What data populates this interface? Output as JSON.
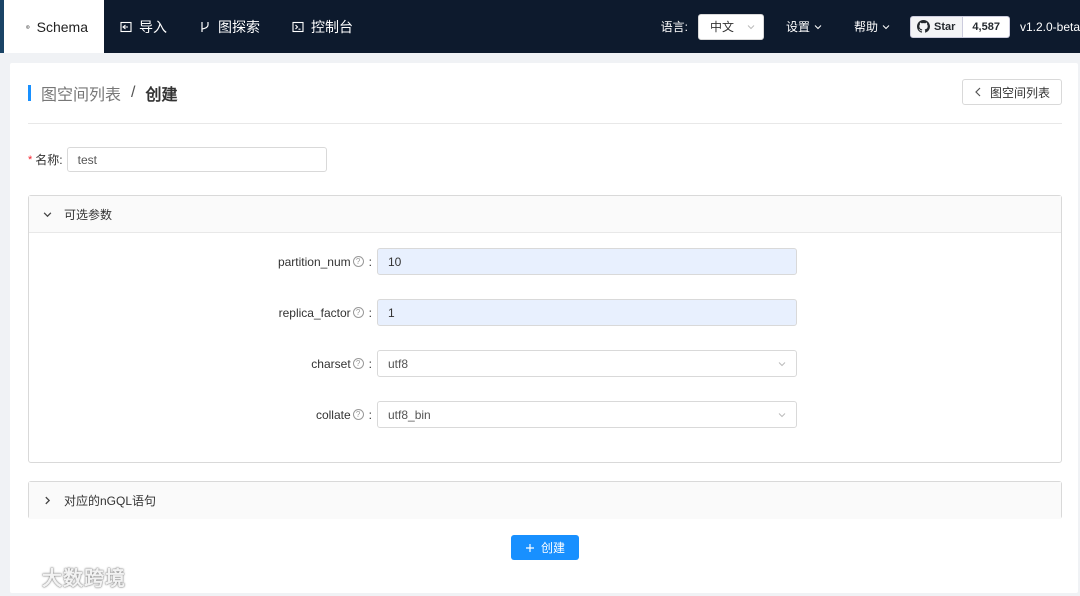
{
  "nav": {
    "items": [
      {
        "label": "Schema",
        "icon": "schema-icon"
      },
      {
        "label": "导入",
        "icon": "import-icon"
      },
      {
        "label": "图探索",
        "icon": "branch-icon"
      },
      {
        "label": "控制台",
        "icon": "console-icon"
      }
    ],
    "lang_label": "语言:",
    "lang_value": "中文",
    "settings": "设置",
    "help": "帮助",
    "github_star": "Star",
    "github_count": "4,587",
    "version": "v1.2.0-beta"
  },
  "header": {
    "parent": "图空间列表",
    "separator": "/",
    "current": "创建",
    "back_label": "图空间列表"
  },
  "form": {
    "name_label": "名称:",
    "name_value": "test",
    "optional_title": "可选参数",
    "fields": [
      {
        "label": "partition_num",
        "value": "10"
      },
      {
        "label": "replica_factor",
        "value": "1"
      },
      {
        "label": "charset",
        "value": "utf8"
      },
      {
        "label": "collate",
        "value": "utf8_bin"
      }
    ],
    "ngql_title": "对应的nGQL语句",
    "create_label": "创建"
  },
  "watermark": "大数跨境",
  "colors": {
    "nav_bg": "#0d1a2d",
    "primary": "#1890ff",
    "filled_bg": "#e8f0fe"
  }
}
